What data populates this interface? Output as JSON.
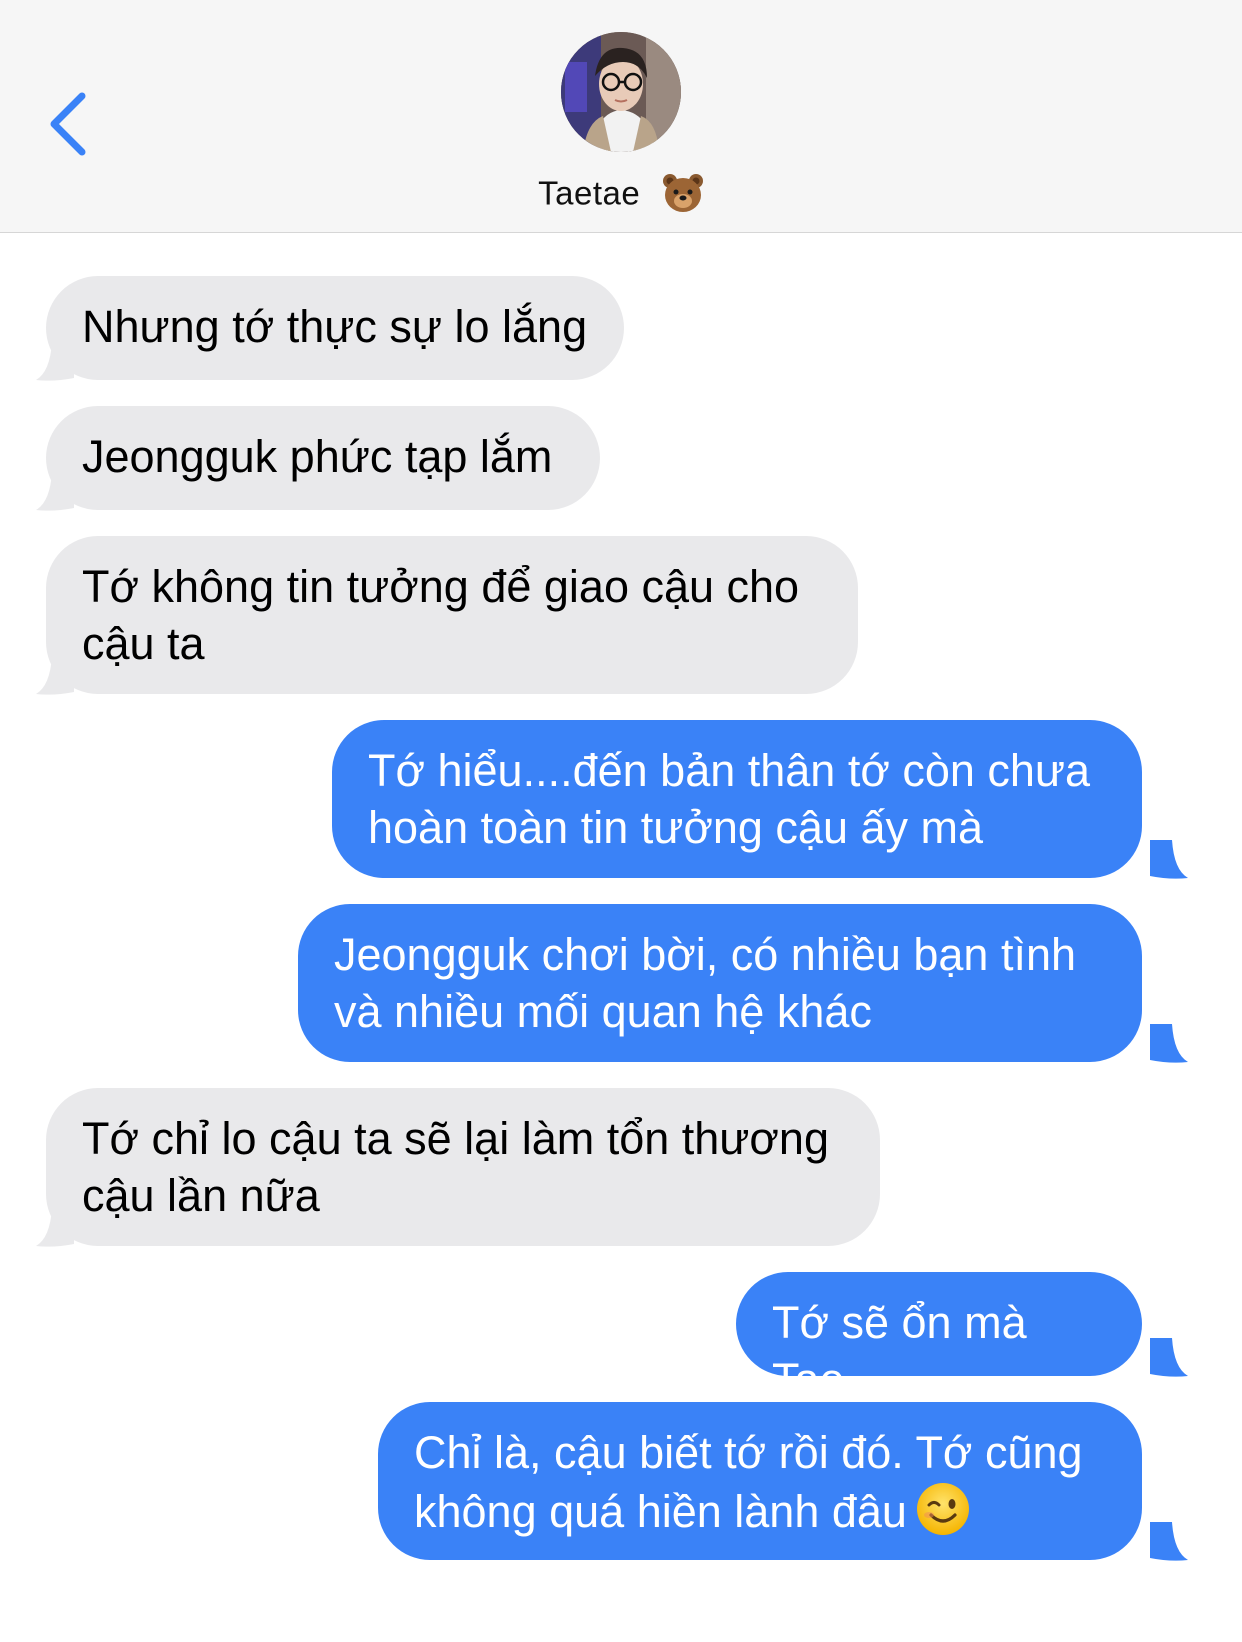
{
  "header": {
    "contact_name": "Taetae",
    "contact_emoji": "bear-face-icon",
    "back_icon": "chevron-left-icon",
    "accent_color": "#3a82f7"
  },
  "messages": [
    {
      "direction": "incoming",
      "text": "Nhưng tớ thực sự lo lắng"
    },
    {
      "direction": "incoming",
      "text": "Jeongguk phức tạp lắm"
    },
    {
      "direction": "incoming",
      "text": "Tớ không tin tưởng để giao cậu cho cậu ta"
    },
    {
      "direction": "outgoing",
      "text": "Tớ hiểu....đến bản thân tớ còn chưa hoàn toàn tin tưởng cậu ấy mà"
    },
    {
      "direction": "outgoing",
      "text": "Jeongguk chơi bời, có nhiều bạn tình và nhiều mối quan hệ khác"
    },
    {
      "direction": "incoming",
      "text": "Tớ chỉ lo cậu ta sẽ lại làm tổn thương cậu lần nữa"
    },
    {
      "direction": "outgoing",
      "text": "Tớ sẽ ổn mà Tae"
    },
    {
      "direction": "outgoing",
      "text": "Chỉ là, cậu biết tớ rồi đó. Tớ cũng không quá hiền lành đâu",
      "trailing_emoji": "winking-face-icon"
    }
  ],
  "colors": {
    "incoming_bubble": "#e9e9eb",
    "outgoing_bubble": "#3a82f7",
    "header_background": "#f6f6f6"
  }
}
